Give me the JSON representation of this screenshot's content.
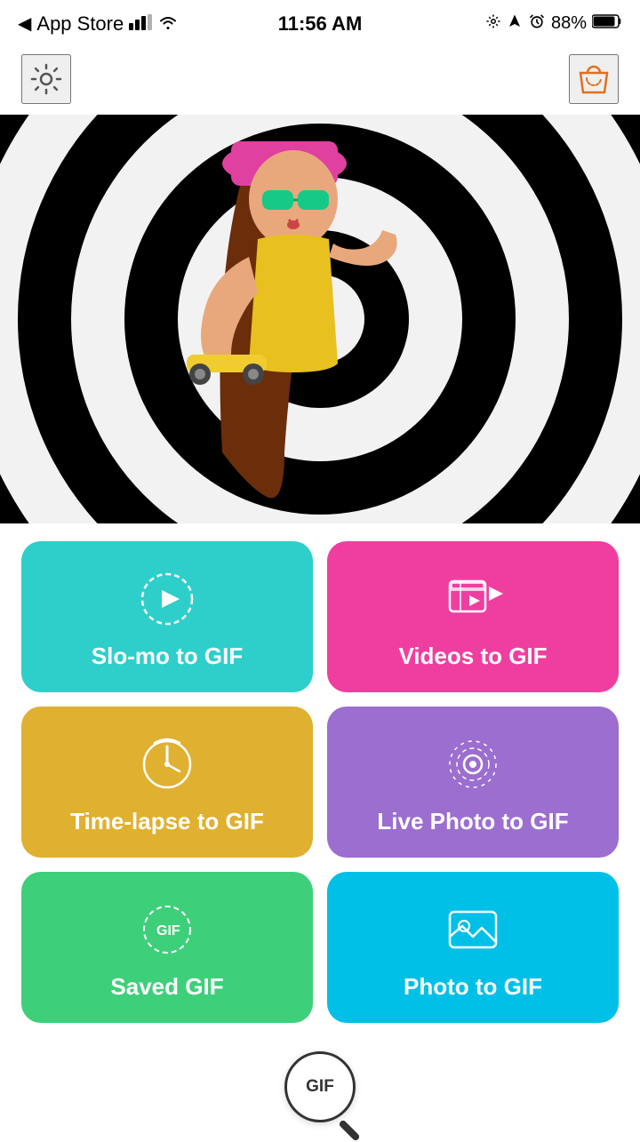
{
  "statusBar": {
    "carrier": "App Store",
    "signal": "●●●",
    "wifi": "wifi",
    "time": "11:56 AM",
    "battery": "88%"
  },
  "header": {
    "gearLabel": "Settings",
    "bagLabel": "Shop"
  },
  "grid": {
    "buttons": [
      {
        "id": "slomo",
        "label": "Slo-mo to GIF",
        "color": "#2ecfca",
        "icon": "slomo"
      },
      {
        "id": "videos",
        "label": "Videos to GIF",
        "color": "#f03ea0",
        "icon": "video"
      },
      {
        "id": "timelapse",
        "label": "Time-lapse to GIF",
        "color": "#e0b030",
        "icon": "timelapse"
      },
      {
        "id": "livephoto",
        "label": "Live Photo to GIF",
        "color": "#9b6ed0",
        "icon": "livephoto"
      },
      {
        "id": "savedgif",
        "label": "Saved GIF",
        "color": "#3ecf7a",
        "icon": "gif"
      },
      {
        "id": "photogif",
        "label": "Photo to GIF",
        "color": "#00c0e8",
        "icon": "photo"
      }
    ]
  },
  "bottomBar": {
    "label": "GIF"
  }
}
